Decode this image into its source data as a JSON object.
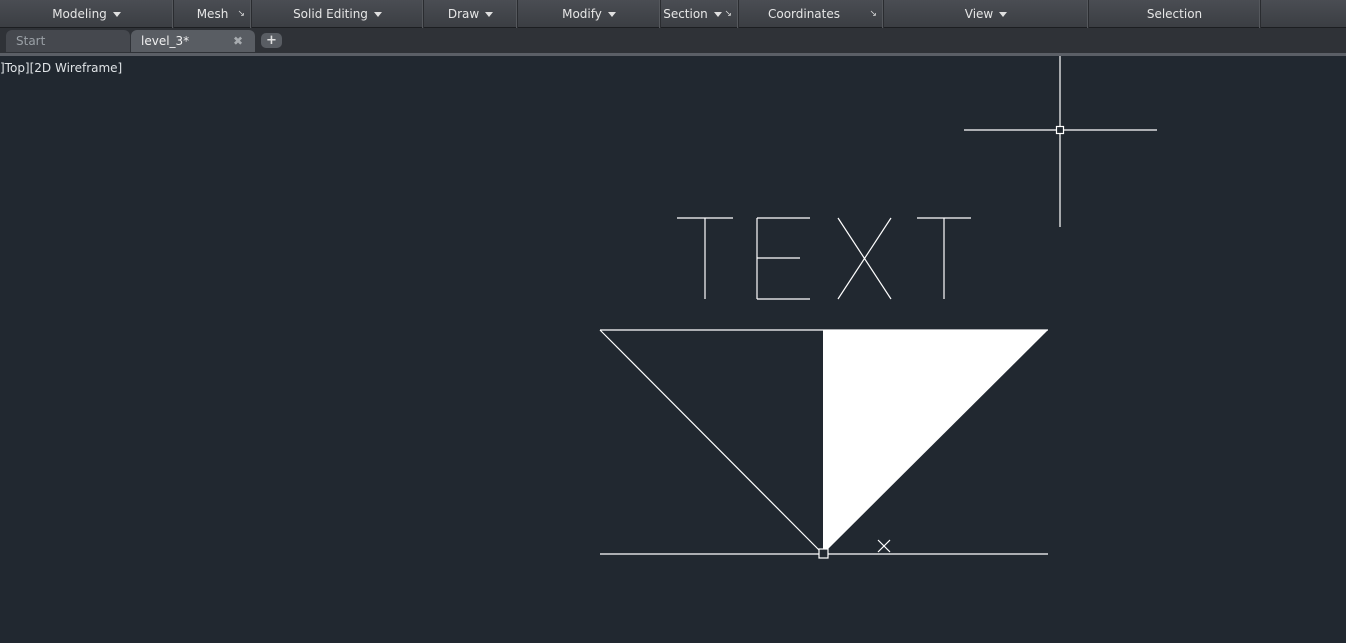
{
  "ribbon": {
    "panels": [
      {
        "label": "Modeling",
        "dropdown": true,
        "launcher": false
      },
      {
        "label": "Mesh",
        "dropdown": false,
        "launcher": true
      },
      {
        "label": "Solid Editing",
        "dropdown": true,
        "launcher": false
      },
      {
        "label": "Draw",
        "dropdown": true,
        "launcher": false
      },
      {
        "label": "Modify",
        "dropdown": true,
        "launcher": false
      },
      {
        "label": "Section",
        "dropdown": true,
        "launcher": true
      },
      {
        "label": "Coordinates",
        "dropdown": false,
        "launcher": true
      },
      {
        "label": "View",
        "dropdown": true,
        "launcher": false
      },
      {
        "label": "Selection",
        "dropdown": false,
        "launcher": false
      }
    ],
    "launcher_glyph": "↘"
  },
  "tabs": {
    "start_label": "Start",
    "active_label": "level_3*",
    "close_glyph": "✖",
    "add_glyph": "+"
  },
  "viewport": {
    "label": "]Top][2D Wireframe]",
    "background": "#212830",
    "drawing_text": "TEXT"
  },
  "colors": {
    "geometry": "#ffffff",
    "ribbon_bg": "#3f4247",
    "active_tab": "#595d63"
  },
  "icons": {
    "crosshair": "crosshair-cursor-icon",
    "snap_marker": "endpoint-snap-marker-icon",
    "x_marker": "x-marker-icon"
  }
}
